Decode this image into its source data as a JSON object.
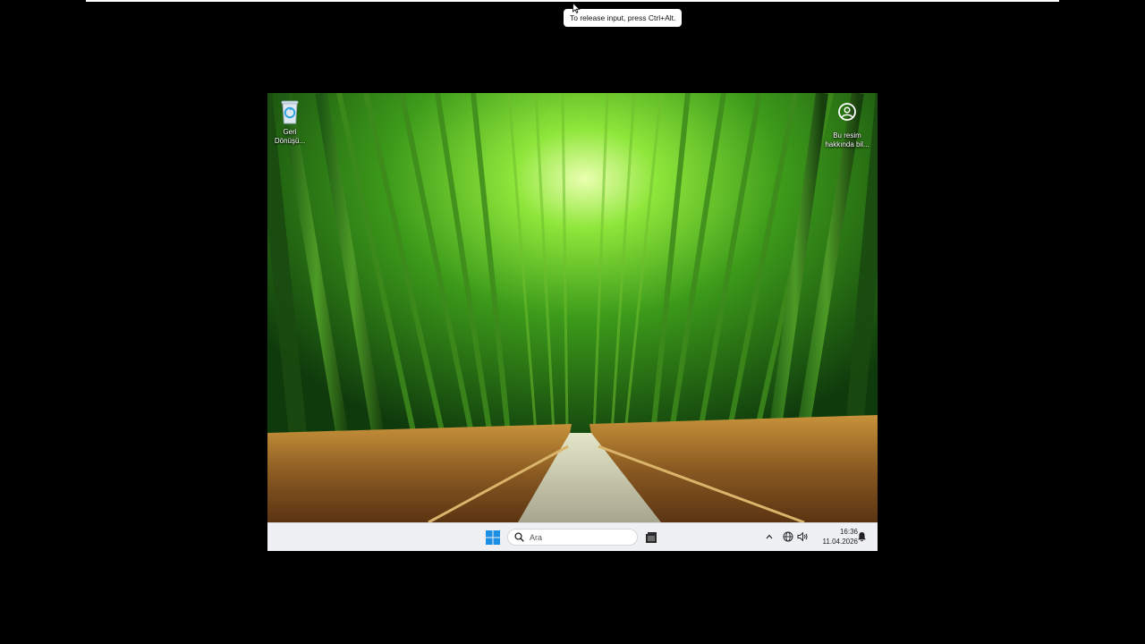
{
  "vm": {
    "release_hint": "To release input, press Ctrl+Alt."
  },
  "desktop": {
    "icons": [
      {
        "id": "recycle-bin",
        "label_line1": "Geri",
        "label_line2": "Dönüşü...",
        "icon": "recycle-bin-icon"
      },
      {
        "id": "about-image",
        "label_line1": "Bu resim",
        "label_line2": "hakkında bil...",
        "icon": "info-person-icon"
      }
    ]
  },
  "taskbar": {
    "search_placeholder": "Ara",
    "start_icon": "windows-logo-icon",
    "accent": "#0078d4",
    "clock_time": "16:36",
    "clock_date": "11.04.2026",
    "tray_icons": [
      "chevron-up-icon",
      "globe-icon",
      "volume-icon",
      "notification-bell-icon"
    ]
  }
}
